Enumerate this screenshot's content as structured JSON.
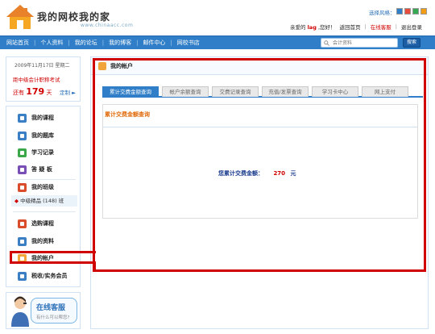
{
  "header": {
    "logo_title": "我的网校我的家",
    "logo_sub": "www.chinaacc.com",
    "style_picker": "选择风格：",
    "swatch_colors": [
      "#2f7ec7",
      "#e74c3c",
      "#34a853",
      "#f39c12"
    ],
    "greeting_prefix": "亲爱的",
    "user": "lag",
    "greeting_suffix": ",您好！",
    "links": [
      "返回首页",
      "在线客服",
      "退出登录"
    ]
  },
  "nav": {
    "items": [
      "网站首页",
      "个人资料",
      "我的论坛",
      "我的博客",
      "邮件中心",
      "网校书店"
    ],
    "search_placeholder": "会计资料",
    "search_button": "搜索"
  },
  "sidebar": {
    "date": "2009年11月17日 星期二",
    "exam": "距中级会计职称考试",
    "remain_prefix": "还有",
    "remain_days": "179",
    "remain_suffix": "天",
    "custom_link": "定制 ►",
    "menu": [
      "我的课程",
      "我的题库",
      "学习记录",
      "答 疑 板",
      "我的班级",
      "选购课程",
      "我的资料",
      "我的帐户",
      "税收/实务会员"
    ],
    "class_item": "中级精品 (148) 班",
    "service_title": "在线客服",
    "service_sub": "有什么可以帮您?"
  },
  "main": {
    "title": "我的帐户",
    "tabs": [
      "累计交费金额查询",
      "帐户余额查询",
      "交费记录查询",
      "充值/发票查询",
      "学习卡中心",
      "网上支付"
    ],
    "active_tab": 0,
    "section_title": "累计交费金额查询",
    "total_label": "您累计交费金额：",
    "total_amount": "270",
    "total_unit": "元"
  },
  "colors": {
    "nav_blue": "#2f7ec7",
    "highlight_red": "#d00000",
    "section_orange": "#e06a0a"
  }
}
